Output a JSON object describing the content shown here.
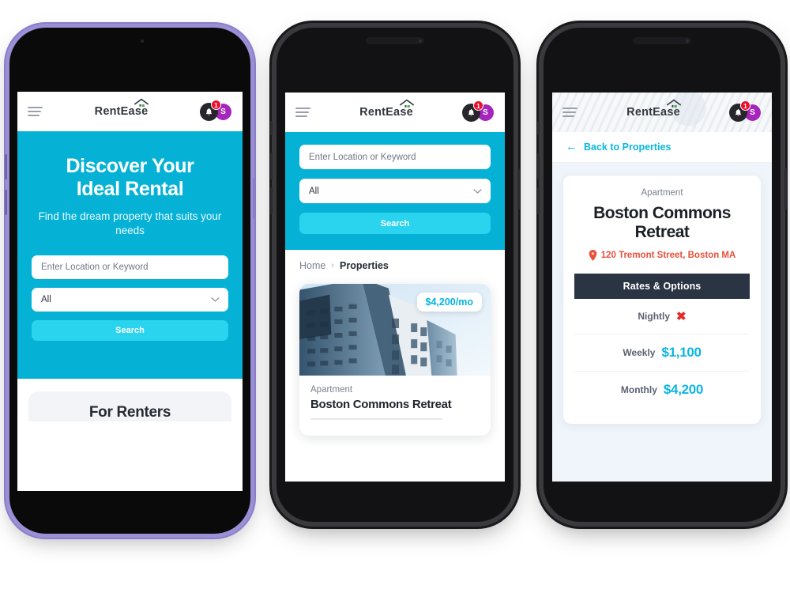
{
  "brand": {
    "name": "RentEase",
    "accent_cyan": "#05b2d6",
    "accent_cyan_light": "#2ad4ef",
    "accent_purple": "#a525bd",
    "badge_red": "#e8112d",
    "dark_navy": "#2b3443",
    "address_red": "#e8503a"
  },
  "header": {
    "menu_icon": "hamburger-icon",
    "logo_text": "RentEase",
    "logo_roof_icon": "house-roof-icon",
    "bell_icon": "bell-icon",
    "notification_count": "1",
    "avatar_initial": "S"
  },
  "phone1": {
    "hero": {
      "title_line1": "Discover Your",
      "title_line2": "Ideal Rental",
      "subtitle": "Find the dream property that suits your needs"
    },
    "search": {
      "location_placeholder": "Enter Location or Keyword",
      "category_value": "All",
      "chevron_icon": "chevron-down-icon",
      "search_button": "Search"
    },
    "section": {
      "renters_title": "For Renters"
    }
  },
  "phone2": {
    "search": {
      "location_placeholder": "Enter Location or Keyword",
      "category_value": "All",
      "chevron_icon": "chevron-down-icon",
      "search_button": "Search"
    },
    "breadcrumb": {
      "home": "Home",
      "separator": "›",
      "current": "Properties"
    },
    "property_card": {
      "price_badge": "$4,200/mo",
      "type": "Apartment",
      "title": "Boston Commons Retreat",
      "image_icon": "building-photo"
    }
  },
  "phone3": {
    "back_link": {
      "arrow_icon": "arrow-left-icon",
      "label": "Back to Properties"
    },
    "detail": {
      "type": "Apartment",
      "title_line1": "Boston Commons",
      "title_line2": "Retreat",
      "pin_icon": "map-pin-icon",
      "address": "120 Tremont Street, Boston MA"
    },
    "rates": {
      "heading": "Rates & Options",
      "rows": [
        {
          "label": "Nightly",
          "value": "✖",
          "unavailable": true
        },
        {
          "label": "Weekly",
          "value": "$1,100",
          "unavailable": false
        },
        {
          "label": "Monthly",
          "value": "$4,200",
          "unavailable": false
        }
      ]
    }
  }
}
